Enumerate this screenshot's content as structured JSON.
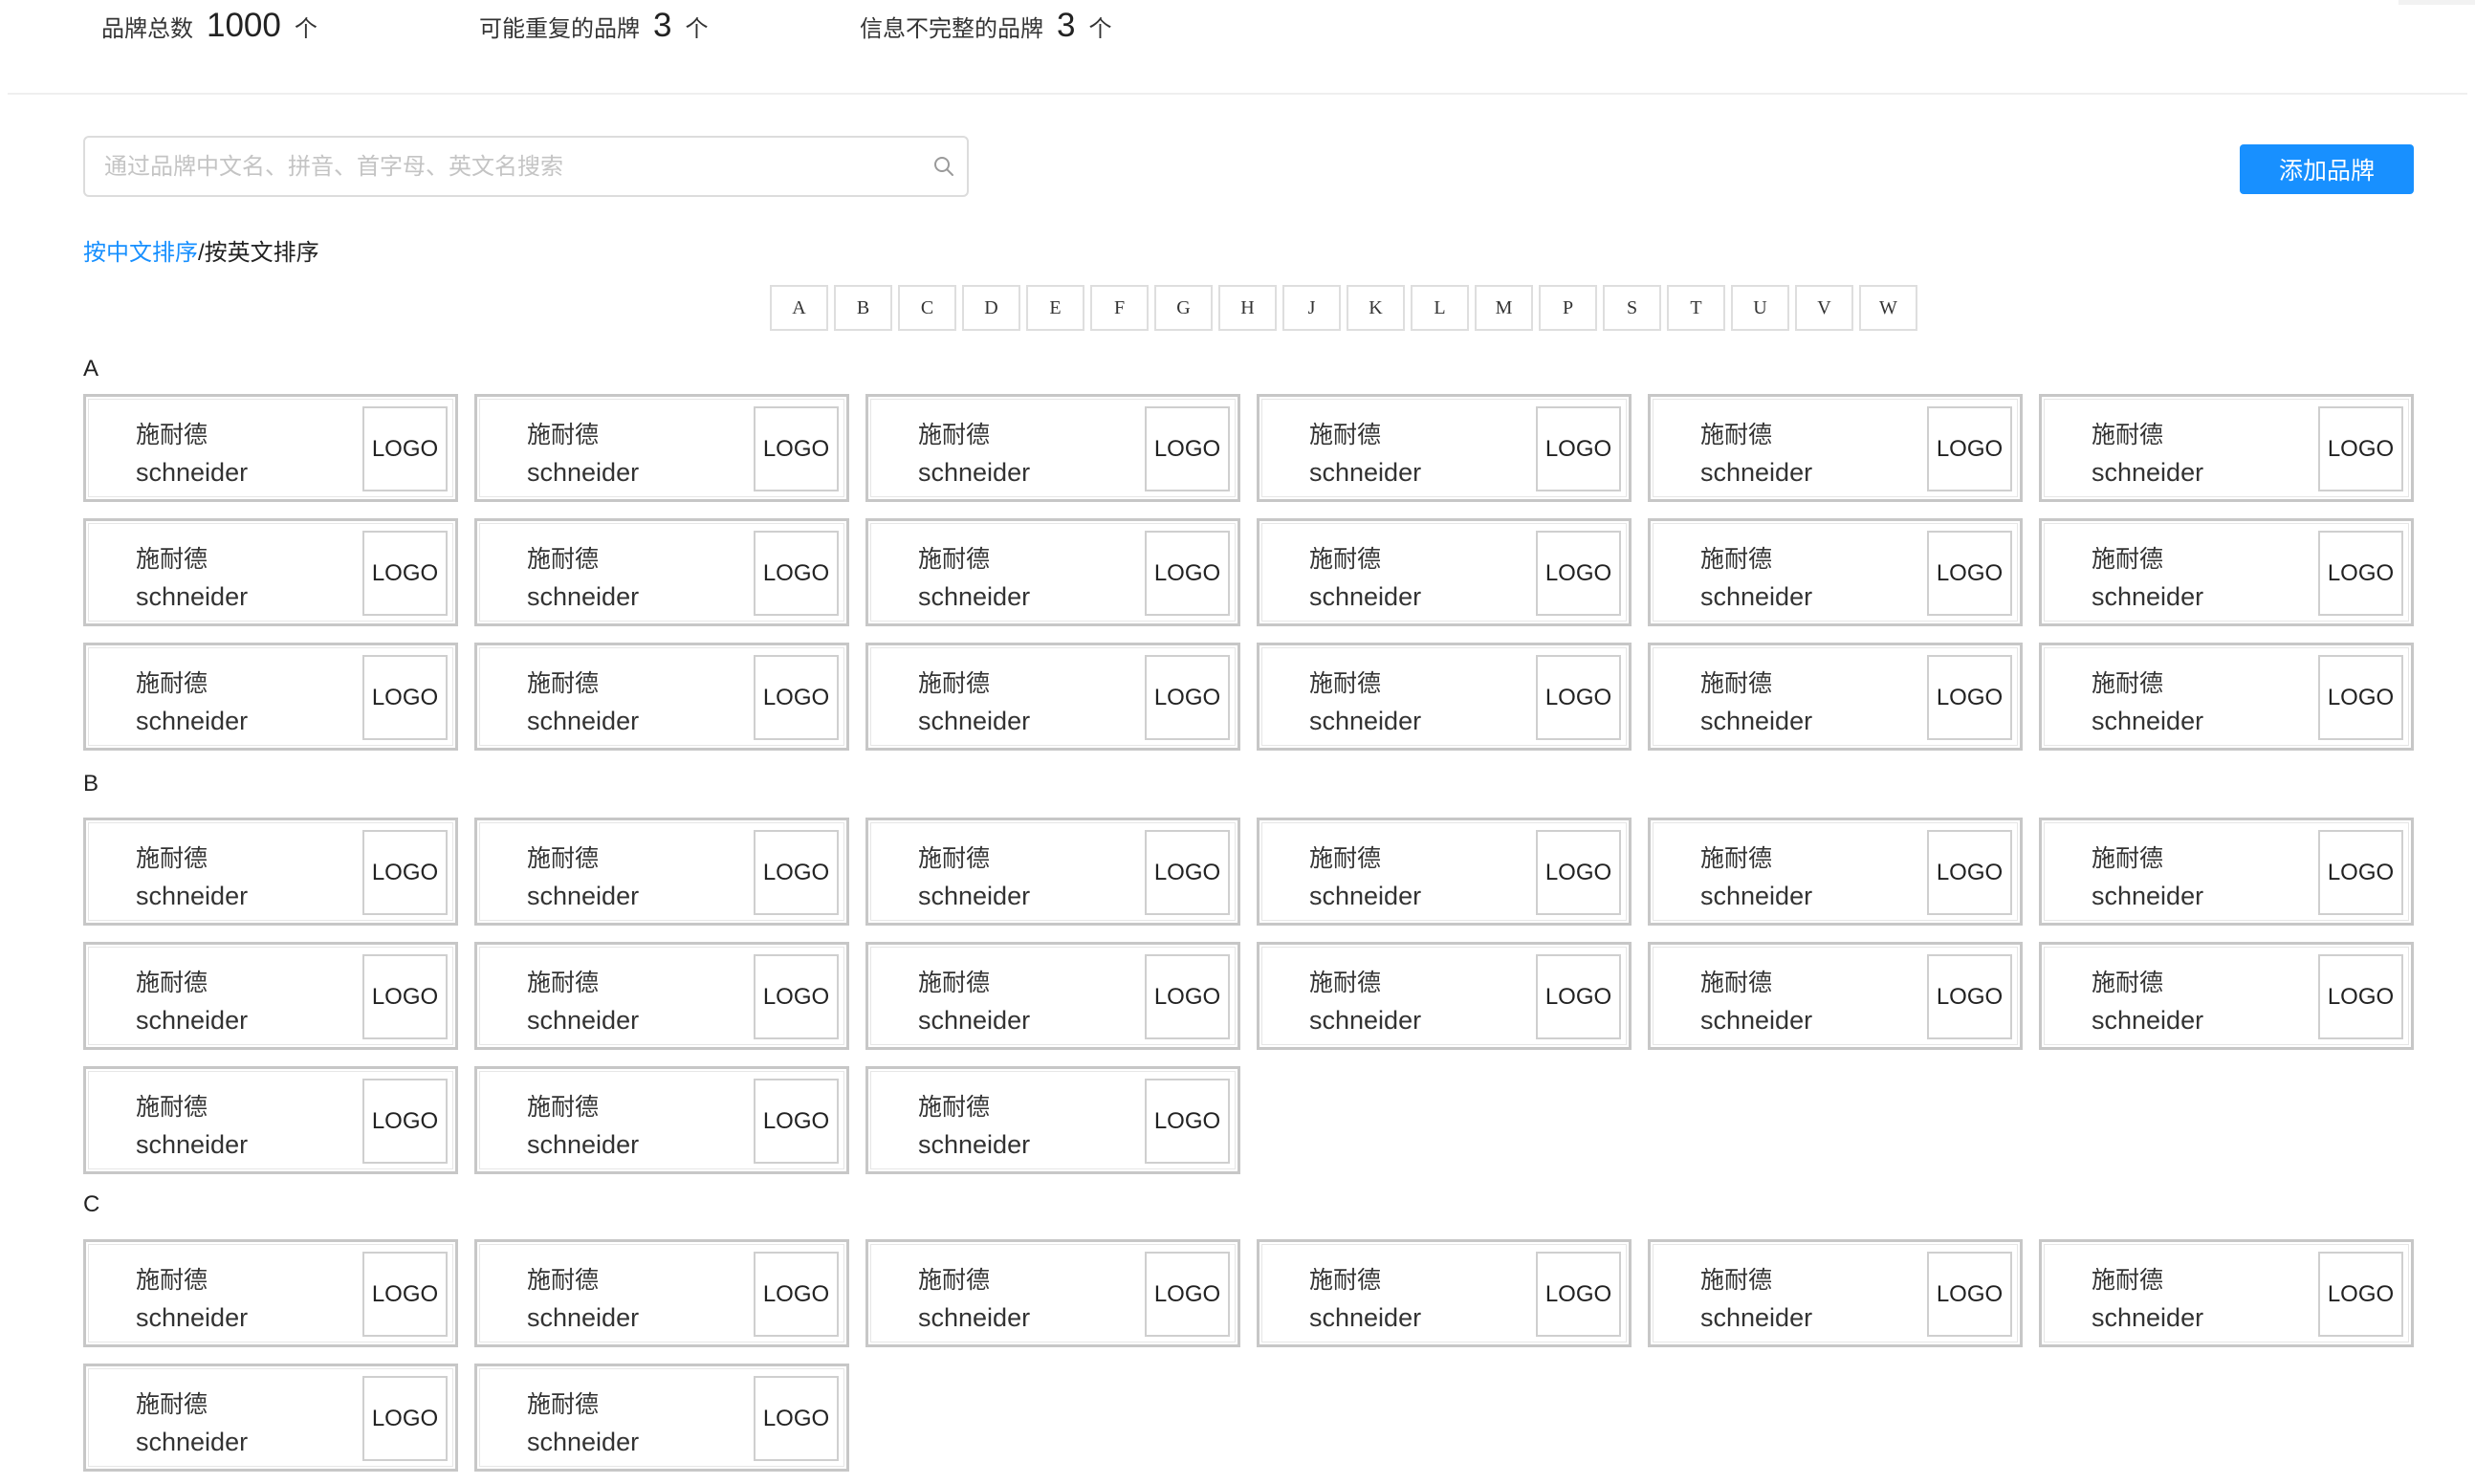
{
  "stats": [
    {
      "label": "品牌总数",
      "value": "1000",
      "unit": "个"
    },
    {
      "label": "可能重复的品牌",
      "value": "3",
      "unit": "个"
    },
    {
      "label": "信息不完整的品牌",
      "value": "3",
      "unit": "个"
    }
  ],
  "search": {
    "placeholder": "通过品牌中文名、拼音、首字母、英文名搜索",
    "value": "",
    "icon": "search-icon"
  },
  "toolbar": {
    "add_label": "添加品牌"
  },
  "sort": {
    "active": "按中文排序",
    "separator": "/",
    "inactive": "按英文排序"
  },
  "letters": [
    "A",
    "B",
    "C",
    "D",
    "E",
    "F",
    "G",
    "H",
    "J",
    "K",
    "L",
    "M",
    "P",
    "S",
    "T",
    "U",
    "V",
    "W"
  ],
  "sections": [
    {
      "letter": "A",
      "brands": [
        {
          "name_cn": "施耐德",
          "name_en": "schneider",
          "logo": "LOGO"
        },
        {
          "name_cn": "施耐德",
          "name_en": "schneider",
          "logo": "LOGO"
        },
        {
          "name_cn": "施耐德",
          "name_en": "schneider",
          "logo": "LOGO"
        },
        {
          "name_cn": "施耐德",
          "name_en": "schneider",
          "logo": "LOGO"
        },
        {
          "name_cn": "施耐德",
          "name_en": "schneider",
          "logo": "LOGO"
        },
        {
          "name_cn": "施耐德",
          "name_en": "schneider",
          "logo": "LOGO"
        },
        {
          "name_cn": "施耐德",
          "name_en": "schneider",
          "logo": "LOGO"
        },
        {
          "name_cn": "施耐德",
          "name_en": "schneider",
          "logo": "LOGO"
        },
        {
          "name_cn": "施耐德",
          "name_en": "schneider",
          "logo": "LOGO"
        },
        {
          "name_cn": "施耐德",
          "name_en": "schneider",
          "logo": "LOGO"
        },
        {
          "name_cn": "施耐德",
          "name_en": "schneider",
          "logo": "LOGO"
        },
        {
          "name_cn": "施耐德",
          "name_en": "schneider",
          "logo": "LOGO"
        },
        {
          "name_cn": "施耐德",
          "name_en": "schneider",
          "logo": "LOGO"
        },
        {
          "name_cn": "施耐德",
          "name_en": "schneider",
          "logo": "LOGO"
        },
        {
          "name_cn": "施耐德",
          "name_en": "schneider",
          "logo": "LOGO"
        },
        {
          "name_cn": "施耐德",
          "name_en": "schneider",
          "logo": "LOGO"
        },
        {
          "name_cn": "施耐德",
          "name_en": "schneider",
          "logo": "LOGO"
        },
        {
          "name_cn": "施耐德",
          "name_en": "schneider",
          "logo": "LOGO"
        }
      ]
    },
    {
      "letter": "B",
      "brands": [
        {
          "name_cn": "施耐德",
          "name_en": "schneider",
          "logo": "LOGO"
        },
        {
          "name_cn": "施耐德",
          "name_en": "schneider",
          "logo": "LOGO"
        },
        {
          "name_cn": "施耐德",
          "name_en": "schneider",
          "logo": "LOGO"
        },
        {
          "name_cn": "施耐德",
          "name_en": "schneider",
          "logo": "LOGO"
        },
        {
          "name_cn": "施耐德",
          "name_en": "schneider",
          "logo": "LOGO"
        },
        {
          "name_cn": "施耐德",
          "name_en": "schneider",
          "logo": "LOGO"
        },
        {
          "name_cn": "施耐德",
          "name_en": "schneider",
          "logo": "LOGO"
        },
        {
          "name_cn": "施耐德",
          "name_en": "schneider",
          "logo": "LOGO"
        },
        {
          "name_cn": "施耐德",
          "name_en": "schneider",
          "logo": "LOGO"
        },
        {
          "name_cn": "施耐德",
          "name_en": "schneider",
          "logo": "LOGO"
        },
        {
          "name_cn": "施耐德",
          "name_en": "schneider",
          "logo": "LOGO"
        },
        {
          "name_cn": "施耐德",
          "name_en": "schneider",
          "logo": "LOGO"
        },
        {
          "name_cn": "施耐德",
          "name_en": "schneider",
          "logo": "LOGO"
        },
        {
          "name_cn": "施耐德",
          "name_en": "schneider",
          "logo": "LOGO"
        },
        {
          "name_cn": "施耐德",
          "name_en": "schneider",
          "logo": "LOGO"
        }
      ]
    },
    {
      "letter": "C",
      "brands": [
        {
          "name_cn": "施耐德",
          "name_en": "schneider",
          "logo": "LOGO"
        },
        {
          "name_cn": "施耐德",
          "name_en": "schneider",
          "logo": "LOGO"
        },
        {
          "name_cn": "施耐德",
          "name_en": "schneider",
          "logo": "LOGO"
        },
        {
          "name_cn": "施耐德",
          "name_en": "schneider",
          "logo": "LOGO"
        },
        {
          "name_cn": "施耐德",
          "name_en": "schneider",
          "logo": "LOGO"
        },
        {
          "name_cn": "施耐德",
          "name_en": "schneider",
          "logo": "LOGO"
        },
        {
          "name_cn": "施耐德",
          "name_en": "schneider",
          "logo": "LOGO"
        },
        {
          "name_cn": "施耐德",
          "name_en": "schneider",
          "logo": "LOGO"
        }
      ]
    }
  ]
}
